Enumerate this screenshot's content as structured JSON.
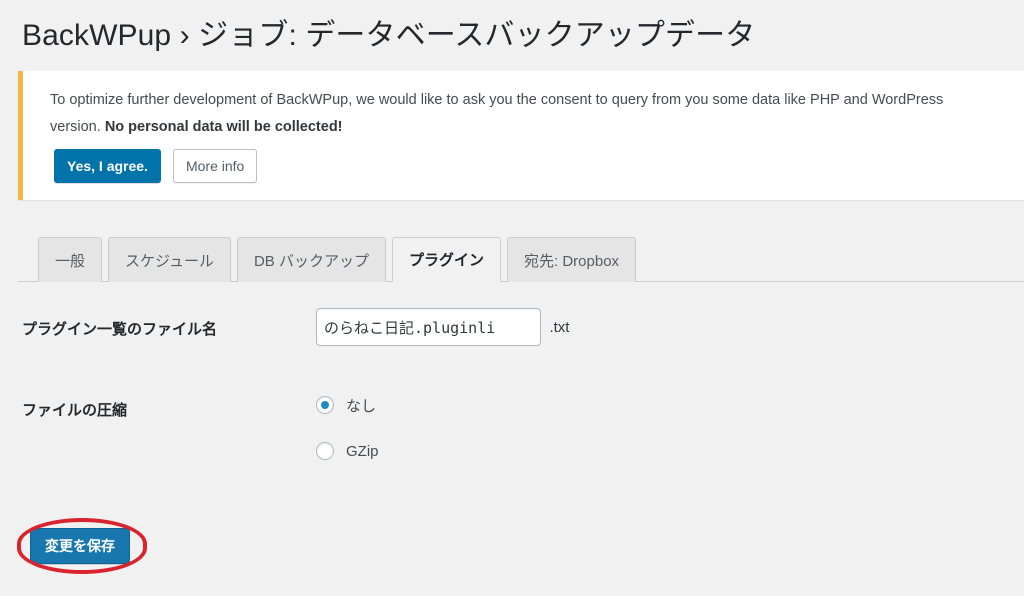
{
  "page": {
    "title": "BackWPup › ジョブ: データベースバックアップデータ"
  },
  "notice": {
    "text_part1": "To optimize further development of BackWPup, we would like to ask you the consent to query from you some data like PHP and WordPress version. ",
    "text_bold": "No personal data will be collected!",
    "agree_label": "Yes, I agree.",
    "more_info_label": "More info",
    "accent_color": "#f0b849",
    "primary_color": "#0073aa"
  },
  "tabs": [
    {
      "label": "一般",
      "active": false
    },
    {
      "label": "スケジュール",
      "active": false
    },
    {
      "label": "DB バックアップ",
      "active": false
    },
    {
      "label": "プラグイン",
      "active": true
    },
    {
      "label": "宛先: Dropbox",
      "active": false
    }
  ],
  "form": {
    "filename_row": {
      "label": "プラグイン一覧のファイル名",
      "value": "のらねこ日記.pluginli",
      "placeholder": "",
      "suffix": ".txt"
    },
    "compression_row": {
      "label": "ファイルの圧縮",
      "options": [
        {
          "label": "なし",
          "checked": true
        },
        {
          "label": "GZip",
          "checked": false
        }
      ],
      "selected_color": "#1e8cbe"
    }
  },
  "footer": {
    "save_label": "変更を保存",
    "save_color": "#1877ae",
    "annotation_color": "#d9232e"
  }
}
